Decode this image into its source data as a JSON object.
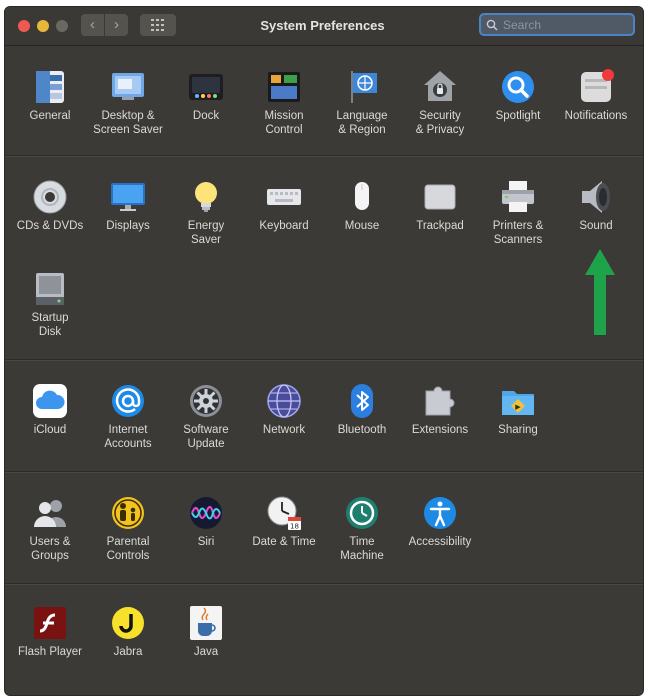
{
  "window": {
    "title": "System Preferences",
    "search_placeholder": "Search"
  },
  "rows": [
    [
      {
        "name": "general",
        "label": "General",
        "icon": "general-icon"
      },
      {
        "name": "desktop-screen-saver",
        "label": "Desktop &\nScreen Saver",
        "icon": "desktop-icon"
      },
      {
        "name": "dock",
        "label": "Dock",
        "icon": "dock-icon"
      },
      {
        "name": "mission-control",
        "label": "Mission\nControl",
        "icon": "mission-control-icon"
      },
      {
        "name": "language-region",
        "label": "Language\n& Region",
        "icon": "language-flag-icon"
      },
      {
        "name": "security-privacy",
        "label": "Security\n& Privacy",
        "icon": "house-lock-icon"
      },
      {
        "name": "spotlight",
        "label": "Spotlight",
        "icon": "magnifier-icon"
      },
      {
        "name": "notifications",
        "label": "Notifications",
        "icon": "notifications-icon"
      }
    ],
    [
      {
        "name": "cds-dvds",
        "label": "CDs & DVDs",
        "icon": "disc-icon"
      },
      {
        "name": "displays",
        "label": "Displays",
        "icon": "display-icon"
      },
      {
        "name": "energy-saver",
        "label": "Energy\nSaver",
        "icon": "lightbulb-icon"
      },
      {
        "name": "keyboard",
        "label": "Keyboard",
        "icon": "keyboard-icon"
      },
      {
        "name": "mouse",
        "label": "Mouse",
        "icon": "mouse-icon"
      },
      {
        "name": "trackpad",
        "label": "Trackpad",
        "icon": "trackpad-icon"
      },
      {
        "name": "printers-scanners",
        "label": "Printers &\nScanners",
        "icon": "printer-icon"
      },
      {
        "name": "sound",
        "label": "Sound",
        "icon": "speaker-icon"
      },
      {
        "name": "startup-disk",
        "label": "Startup\nDisk",
        "icon": "hard-drive-icon"
      }
    ],
    [
      {
        "name": "icloud",
        "label": "iCloud",
        "icon": "cloud-icon"
      },
      {
        "name": "internet-accounts",
        "label": "Internet\nAccounts",
        "icon": "at-sign-icon"
      },
      {
        "name": "software-update",
        "label": "Software\nUpdate",
        "icon": "gear-icon"
      },
      {
        "name": "network",
        "label": "Network",
        "icon": "globe-icon"
      },
      {
        "name": "bluetooth",
        "label": "Bluetooth",
        "icon": "bluetooth-icon"
      },
      {
        "name": "extensions",
        "label": "Extensions",
        "icon": "puzzle-icon"
      },
      {
        "name": "sharing",
        "label": "Sharing",
        "icon": "sharing-folder-icon"
      }
    ],
    [
      {
        "name": "users-groups",
        "label": "Users &\nGroups",
        "icon": "users-icon"
      },
      {
        "name": "parental-controls",
        "label": "Parental\nControls",
        "icon": "parental-icon"
      },
      {
        "name": "siri",
        "label": "Siri",
        "icon": "siri-icon"
      },
      {
        "name": "date-time",
        "label": "Date & Time",
        "icon": "clock-icon"
      },
      {
        "name": "time-machine",
        "label": "Time\nMachine",
        "icon": "time-machine-icon"
      },
      {
        "name": "accessibility",
        "label": "Accessibility",
        "icon": "accessibility-icon"
      }
    ],
    [
      {
        "name": "flash-player",
        "label": "Flash Player",
        "icon": "flash-icon"
      },
      {
        "name": "jabra",
        "label": "Jabra",
        "icon": "jabra-icon"
      },
      {
        "name": "java",
        "label": "Java",
        "icon": "java-cup-icon"
      }
    ]
  ],
  "annotation": {
    "icon": "green-arrow-up-icon",
    "color": "#1fa34a"
  },
  "colors": {
    "window_bg": "#3c3a36",
    "label_text": "#dcdad6",
    "search_border": "#4a84c8"
  }
}
